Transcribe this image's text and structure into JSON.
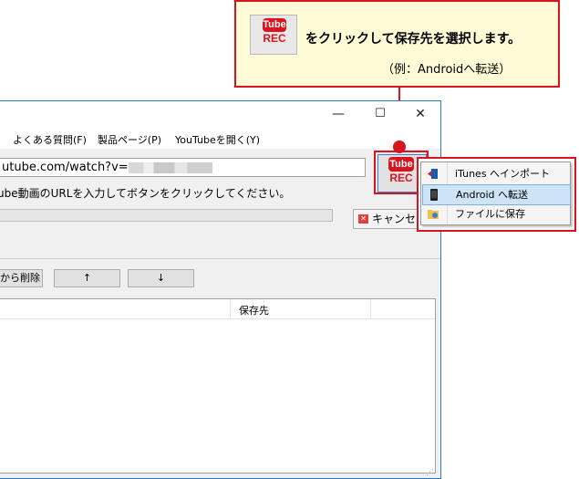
{
  "callout": {
    "icon": {
      "tube": "Tube",
      "rec": "REC"
    },
    "line1": "をクリックして保存先を選択します。",
    "line2": "（例：Androidへ転送）"
  },
  "window": {
    "controls": {
      "minimize": "—",
      "maximize": "☐",
      "close": "✕"
    },
    "menu": [
      "よくある質問(F)",
      "製品ページ(P)",
      "YouTubeを開く(Y)"
    ],
    "url_value": "utube.com/watch?v=",
    "hint": "ube動画のURLを入力してボタンをクリックしてください。",
    "cancel_label": "キャンセル",
    "buttons": {
      "remove": "から削除",
      "up": "↑",
      "down": "↓"
    },
    "list_columns": {
      "dest": "保存先"
    },
    "rec_button": {
      "tube": "Tube",
      "rec": "REC"
    }
  },
  "dropdown": {
    "items": [
      {
        "label": "iTunes へインポート",
        "icon": "itunes-import-icon"
      },
      {
        "label": "Android へ転送",
        "icon": "android-device-icon",
        "selected": true
      },
      {
        "label": "ファイルに保存",
        "icon": "folder-save-icon"
      }
    ]
  },
  "colors": {
    "accent_red": "#d8141e",
    "callout_bg": "#fffbd6",
    "window_border": "#2b7ac9",
    "selected_bg": "#cde4f7"
  }
}
